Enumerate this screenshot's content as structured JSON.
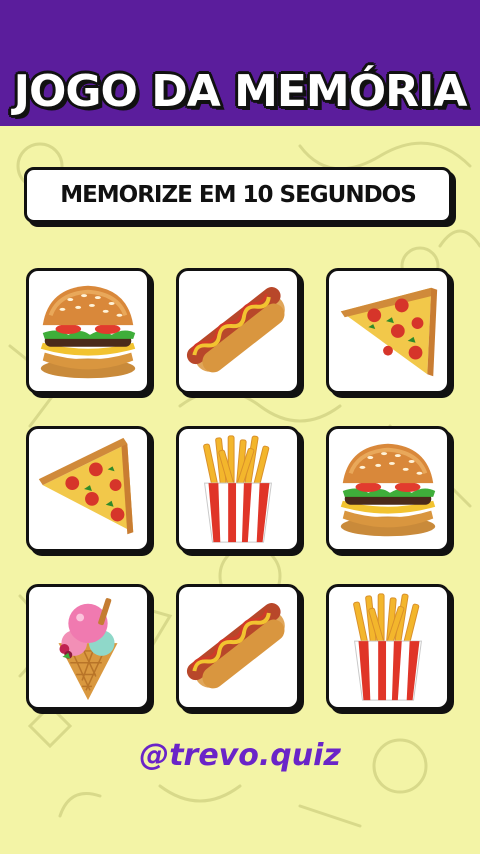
{
  "header": {
    "title": "JOGO DA MEMÓRIA"
  },
  "instruction": {
    "text": "MEMORIZE EM 10 SEGUNDOS"
  },
  "cards": [
    {
      "item": "hamburger",
      "icon": "burger-icon"
    },
    {
      "item": "hot-dog",
      "icon": "hotdog-icon"
    },
    {
      "item": "pizza-slice",
      "icon": "pizza-icon"
    },
    {
      "item": "pizza-slice",
      "icon": "pizza-icon"
    },
    {
      "item": "french-fries",
      "icon": "fries-icon"
    },
    {
      "item": "hamburger",
      "icon": "burger-icon"
    },
    {
      "item": "ice-cream-cone",
      "icon": "icecream-icon"
    },
    {
      "item": "hot-dog",
      "icon": "hotdog-icon"
    },
    {
      "item": "french-fries",
      "icon": "fries-icon"
    }
  ],
  "footer": {
    "handle": "@trevo.quiz"
  },
  "colors": {
    "header": "#5b1d9c",
    "background": "#f3f4a6",
    "handle": "#6a24c8"
  }
}
